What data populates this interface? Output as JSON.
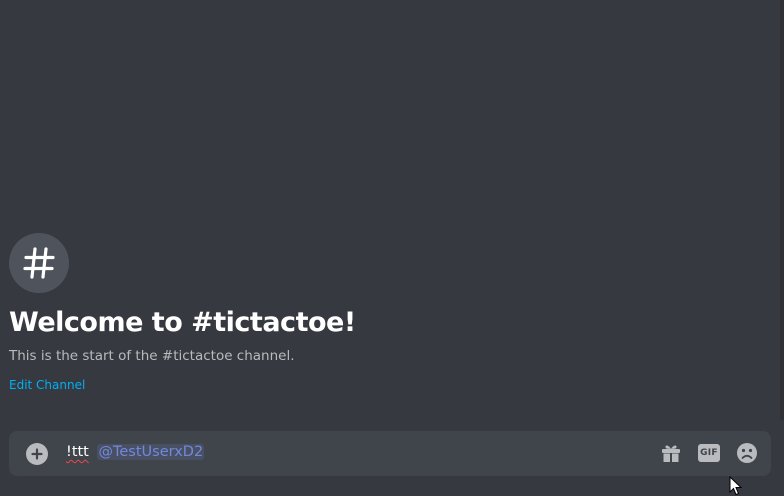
{
  "channel": {
    "icon": "hash-icon",
    "welcome_title": "Welcome to #tictactoe!",
    "description": "This is the start of the #tictactoe channel.",
    "edit_label": "Edit Channel"
  },
  "composer": {
    "command_text": "!ttt",
    "mention_text": "@TestUserxD2",
    "attach_icon": "plus-circle-icon",
    "gift_icon": "gift-icon",
    "gif_label": "GIF",
    "emoji_icon": "sad-face-emoji-icon"
  },
  "colors": {
    "background": "#36393f",
    "composer": "#40444b",
    "link": "#00b0f4",
    "mention": "#7289da"
  }
}
